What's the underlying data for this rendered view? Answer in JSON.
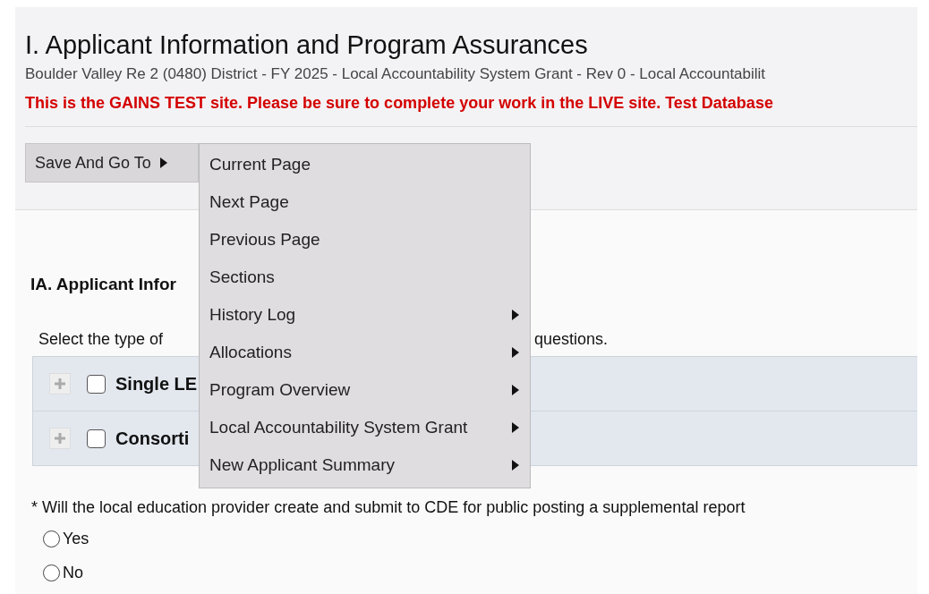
{
  "header": {
    "title": "I. Applicant Information and Program Assurances",
    "subtitle": "Boulder Valley Re 2 (0480) District - FY 2025 - Local Accountability System Grant - Rev 0 - Local Accountabilit",
    "warning": "This is the GAINS TEST site. Please be sure to complete your work in the LIVE site. Test Database"
  },
  "save_button": {
    "label": "Save And Go To"
  },
  "menu": {
    "items": [
      {
        "label": "Current Page",
        "has_submenu": false
      },
      {
        "label": "Next Page",
        "has_submenu": false
      },
      {
        "label": "Previous Page",
        "has_submenu": false
      },
      {
        "label": "Sections",
        "has_submenu": false
      },
      {
        "label": "History Log",
        "has_submenu": true
      },
      {
        "label": "Allocations",
        "has_submenu": true
      },
      {
        "label": "Program Overview",
        "has_submenu": true
      },
      {
        "label": "Local Accountability System Grant",
        "has_submenu": true
      },
      {
        "label": "New Applicant Summary",
        "has_submenu": true
      }
    ]
  },
  "section": {
    "heading": "IA. Applicant Infor",
    "instruction_left": "Select the type of",
    "instruction_right": "questions.",
    "options": [
      {
        "label": "Single LE",
        "checked": false
      },
      {
        "label": "Consorti",
        "checked": false
      }
    ]
  },
  "question": {
    "text": "* Will the local education provider create and submit to CDE for public posting a supplemental report",
    "choices": [
      {
        "label": "Yes",
        "selected": false
      },
      {
        "label": "No",
        "selected": false
      }
    ]
  }
}
